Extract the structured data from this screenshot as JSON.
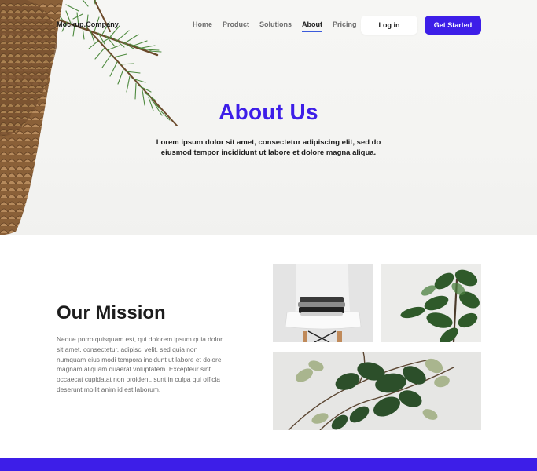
{
  "brand": {
    "logo_text": "Mockup.Company"
  },
  "nav": {
    "items": [
      {
        "label": "Home",
        "active": false
      },
      {
        "label": "Product",
        "active": false
      },
      {
        "label": "Solutions",
        "active": false
      },
      {
        "label": "About",
        "active": true
      },
      {
        "label": "Pricing",
        "active": false
      }
    ]
  },
  "header_actions": {
    "login_label": "Log in",
    "cta_label": "Get Started"
  },
  "hero": {
    "title": "About Us",
    "subtitle": "Lorem ipsum dolor sit amet, consectetur adipiscing elit, sed do eiusmod tempor incididunt ut labore et dolore magna aliqua."
  },
  "mission": {
    "title": "Our Mission",
    "body": "Neque porro quisquam est, qui dolorem ipsum quia dolor sit amet, consectetur, adipisci velit, sed quia non numquam eius modi tempora incidunt ut labore et dolore magnam aliquam quaerat voluptatem. Excepteur sint occaecat cupidatat non proident, sunt in culpa qui officia deserunt mollit anim id est laborum."
  },
  "colors": {
    "accent": "#3d1ee8",
    "text_dark": "#1c1c1c",
    "text_muted": "#6a6a6a",
    "hero_bg": "#f4f4f2"
  }
}
